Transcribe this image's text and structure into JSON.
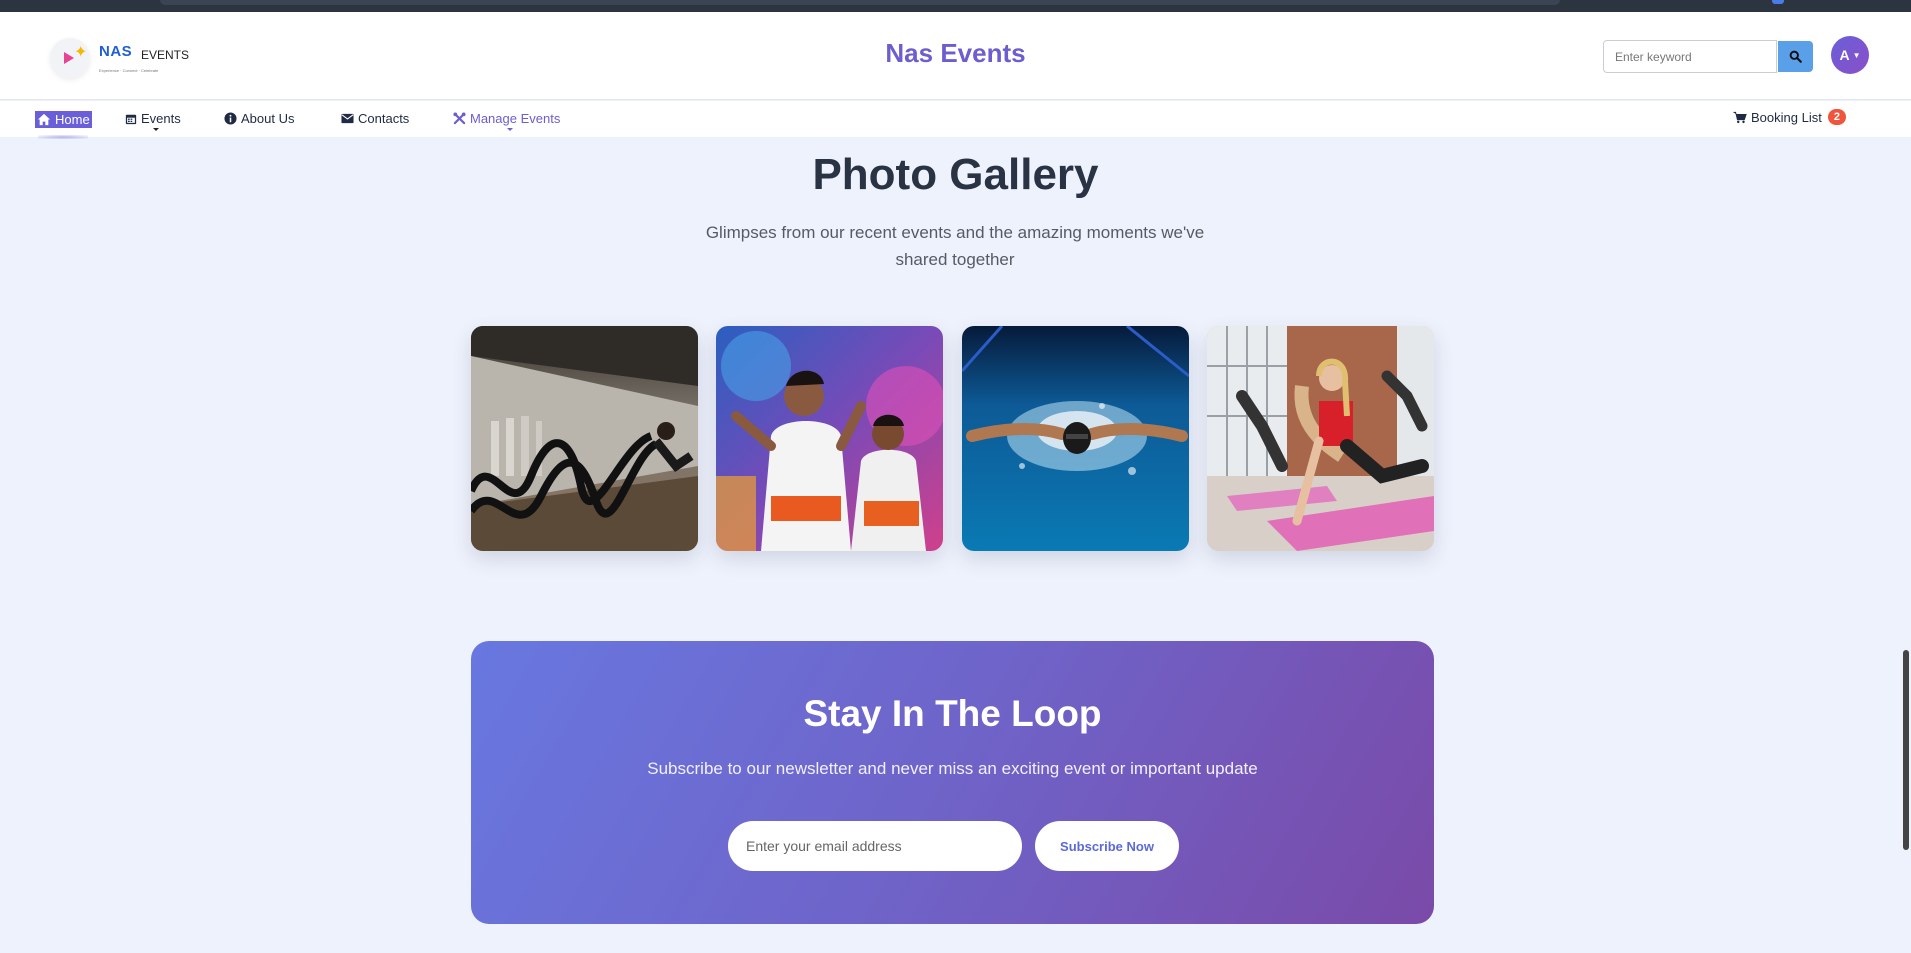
{
  "header": {
    "logo_brand": "NAS",
    "logo_events": "EVENTS",
    "logo_tagline": "Experience · Connect · Celebrate",
    "site_title": "Nas Events",
    "search_placeholder": "Enter keyword",
    "search_icon": "search-icon",
    "avatar_initial": "A"
  },
  "nav": {
    "items": [
      {
        "label": "Home",
        "icon": "home-icon"
      },
      {
        "label": "Events",
        "icon": "calendar-icon"
      },
      {
        "label": "About Us",
        "icon": "info-icon"
      },
      {
        "label": "Contacts",
        "icon": "envelope-icon"
      },
      {
        "label": "Manage Events",
        "icon": "tools-icon"
      }
    ],
    "booking": {
      "label": "Booking List",
      "count": "2",
      "icon": "cart-icon"
    }
  },
  "gallery": {
    "title": "Photo Gallery",
    "subtitle": "Glimpses from our recent events and the amazing moments we've shared together"
  },
  "newsletter": {
    "title": "Stay In The Loop",
    "text": "Subscribe to our newsletter and never miss an exciting event or important update",
    "email_placeholder": "Enter your email address",
    "button_label": "Subscribe Now"
  },
  "colors": {
    "accent": "#6c5ecf",
    "badge": "#f0543c",
    "page_bg": "#eef2fc"
  }
}
